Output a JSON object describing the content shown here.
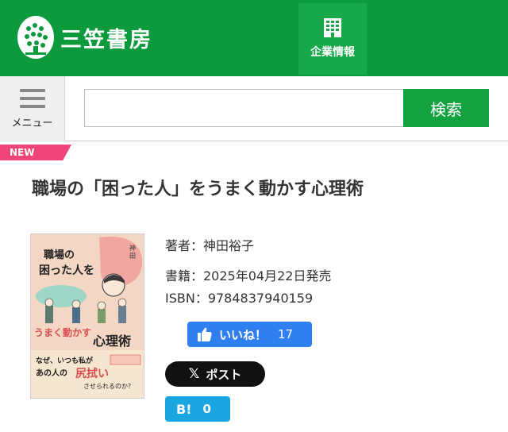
{
  "header": {
    "logo_text": "三笠書房",
    "corporate_label": "企業情報"
  },
  "search": {
    "menu_label": "メニュー",
    "placeholder": "",
    "button_label": "検索"
  },
  "badge": "NEW",
  "book": {
    "title": "職場の「困った人」をうまく動かす心理術",
    "author": "著者：神田裕子",
    "published": "書籍：2025年04月22日発売",
    "isbn": "ISBN：9784837940159",
    "cover": {
      "title_top": "職場の困った人を",
      "title_bottom": "うまく動かす心理術",
      "author": "神田裕子",
      "tagline_1": "なぜ、いつも私が",
      "tagline_2": "あの人の尻拭い",
      "tagline_3": "させられるのか？"
    }
  },
  "social": {
    "like_label": "いいね！",
    "like_count": "17",
    "x_label": "ポスト",
    "hatena_label": "B!",
    "hatena_count": "0"
  },
  "colors": {
    "brand_green": "#0c9a3c",
    "search_green": "#13a23f",
    "new_pink": "#f0457b",
    "like_blue": "#2f7ff0",
    "hatena_blue": "#1aa6e0"
  },
  "icons": [
    "logo-emblem",
    "building-icon",
    "hamburger-icon",
    "thumbs-up-icon",
    "x-logo-icon"
  ]
}
